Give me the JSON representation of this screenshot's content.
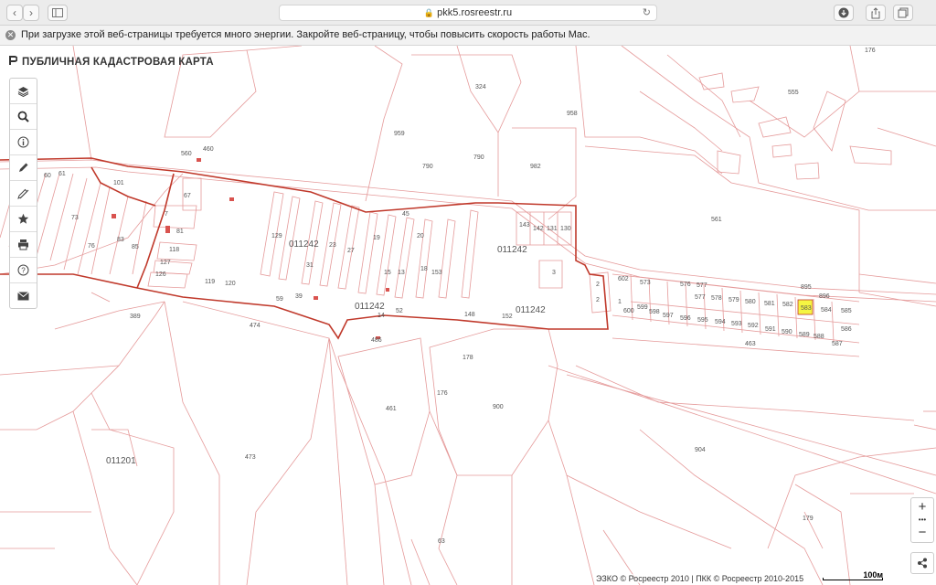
{
  "browser": {
    "url": "pkk5.rosreestr.ru",
    "back_icon": "chevron-left-icon",
    "forward_icon": "chevron-right-icon"
  },
  "notice": {
    "text": "При загрузке этой веб-страницы требуется много энергии. Закройте веб-страницу, чтобы повысить скорость работы Mac."
  },
  "app": {
    "title": "ПУБЛИЧНАЯ КАДАСТРОВАЯ КАРТА"
  },
  "tools": [
    {
      "name": "layers-tool",
      "icon": "layers-icon"
    },
    {
      "name": "search-tool",
      "icon": "search-icon"
    },
    {
      "name": "info-tool",
      "icon": "info-icon"
    },
    {
      "name": "draw-tool",
      "icon": "pencil-icon"
    },
    {
      "name": "measure-tool",
      "icon": "ruler-pencil-icon"
    },
    {
      "name": "favorites-tool",
      "icon": "star-icon"
    },
    {
      "name": "print-tool",
      "icon": "printer-icon"
    },
    {
      "name": "help-tool",
      "icon": "question-icon"
    },
    {
      "name": "feedback-tool",
      "icon": "envelope-icon"
    }
  ],
  "map": {
    "quarter_labels": [
      "011242",
      "011242",
      "011242",
      "011242",
      "011201"
    ],
    "parcel_labels": [
      "324",
      "958",
      "176",
      "555",
      "790",
      "790",
      "982",
      "561",
      "959",
      "560",
      "460",
      "67",
      "7",
      "81",
      "118",
      "127",
      "126",
      "129",
      "31",
      "23",
      "27",
      "19",
      "15",
      "13",
      "45",
      "20",
      "18",
      "153",
      "143",
      "142",
      "131",
      "130",
      "3",
      "2",
      "2",
      "602",
      "1",
      "600",
      "599",
      "573",
      "576",
      "577",
      "577",
      "578",
      "579",
      "580",
      "581",
      "582",
      "583",
      "584",
      "585",
      "586",
      "587",
      "588",
      "589",
      "590",
      "591",
      "592",
      "593",
      "594",
      "595",
      "596",
      "597",
      "598",
      "895",
      "896",
      "463",
      "474",
      "389",
      "486",
      "52",
      "148",
      "152",
      "178",
      "176",
      "461",
      "900",
      "904",
      "473",
      "179",
      "63",
      "14",
      "59",
      "39",
      "120",
      "119",
      "85",
      "83",
      "76",
      "101",
      "61",
      "60",
      "73",
      "93"
    ],
    "highlight_color": "#f5f542",
    "boundary_color": "#c0392b",
    "parcel_color": "#e59a9a"
  },
  "zoom": {
    "plus": "+",
    "minus": "−",
    "dots": "•••"
  },
  "attribution": "ЭЗКО © Росреестр 2010 | ПКК © Росреестр 2010-2015",
  "scale_label": "100м"
}
